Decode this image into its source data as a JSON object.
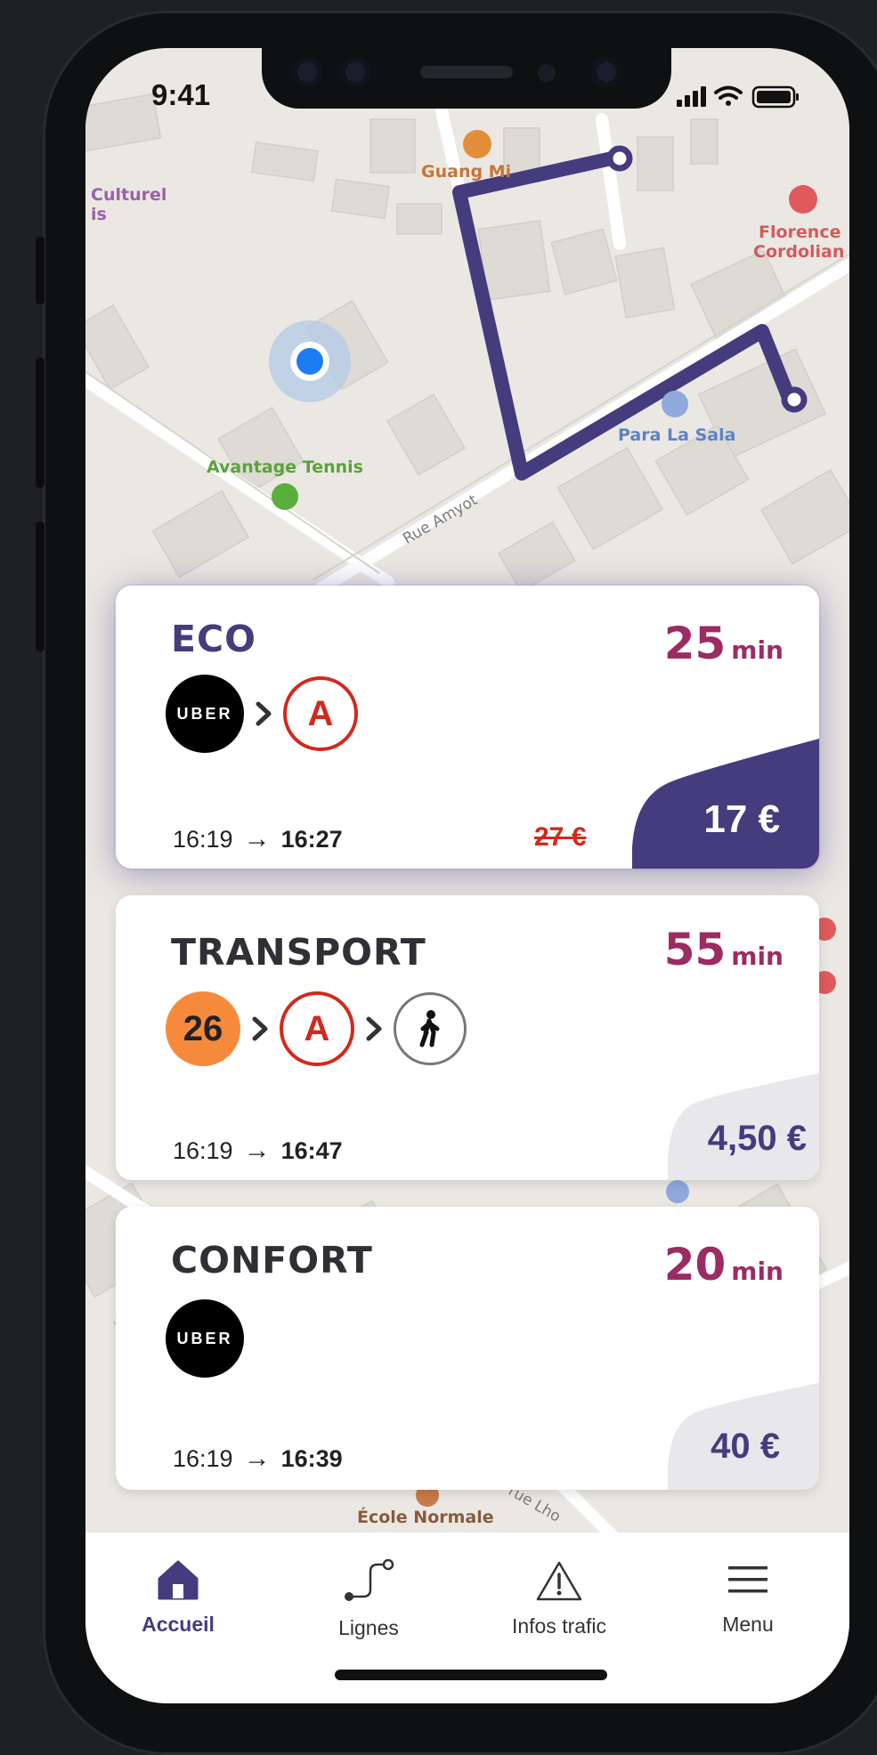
{
  "status": {
    "time": "9:41"
  },
  "map": {
    "labels": {
      "poi_top": "Guang Mi",
      "culturel": "Culturel",
      "culturel2": "is",
      "florence": "Florence",
      "cordolian": "Cordolian",
      "para": "Para La Sala",
      "tennis": "Avantage Tennis",
      "street": "Rue Amyot",
      "ecole": "École Normale",
      "street2": "rue Lho"
    }
  },
  "routes": [
    {
      "title": "ECO",
      "duration": "25",
      "duration_unit": "min",
      "legs": [
        "uber",
        "rer-a"
      ],
      "uber_label": "UBER",
      "rer_label": "A",
      "depart": "16:19",
      "arrive": "16:27",
      "old_price": "27 €",
      "price": "17 €",
      "selected": true
    },
    {
      "title": "TRANSPORT",
      "duration": "55",
      "duration_unit": "min",
      "legs": [
        "bus-26",
        "rer-a",
        "walk"
      ],
      "bus_label": "26",
      "rer_label": "A",
      "depart": "16:19",
      "arrive": "16:47",
      "price": "4,50 €",
      "selected": false
    },
    {
      "title": "CONFORT",
      "duration": "20",
      "duration_unit": "min",
      "legs": [
        "uber"
      ],
      "uber_label": "UBER",
      "depart": "16:19",
      "arrive": "16:39",
      "price": "40 €",
      "selected": false
    }
  ],
  "tabbar": {
    "items": [
      {
        "label": "Accueil",
        "icon": "home-icon",
        "active": true
      },
      {
        "label": "Lignes",
        "icon": "route-icon",
        "active": false
      },
      {
        "label": "Infos trafic",
        "icon": "warning-icon",
        "active": false
      },
      {
        "label": "Menu",
        "icon": "menu-icon",
        "active": false
      }
    ]
  },
  "colors": {
    "brand": "#453c7e",
    "duration": "#9b2c63",
    "rer": "#d2291c",
    "bus": "#f58a3c",
    "route_line": "#453c7e"
  }
}
